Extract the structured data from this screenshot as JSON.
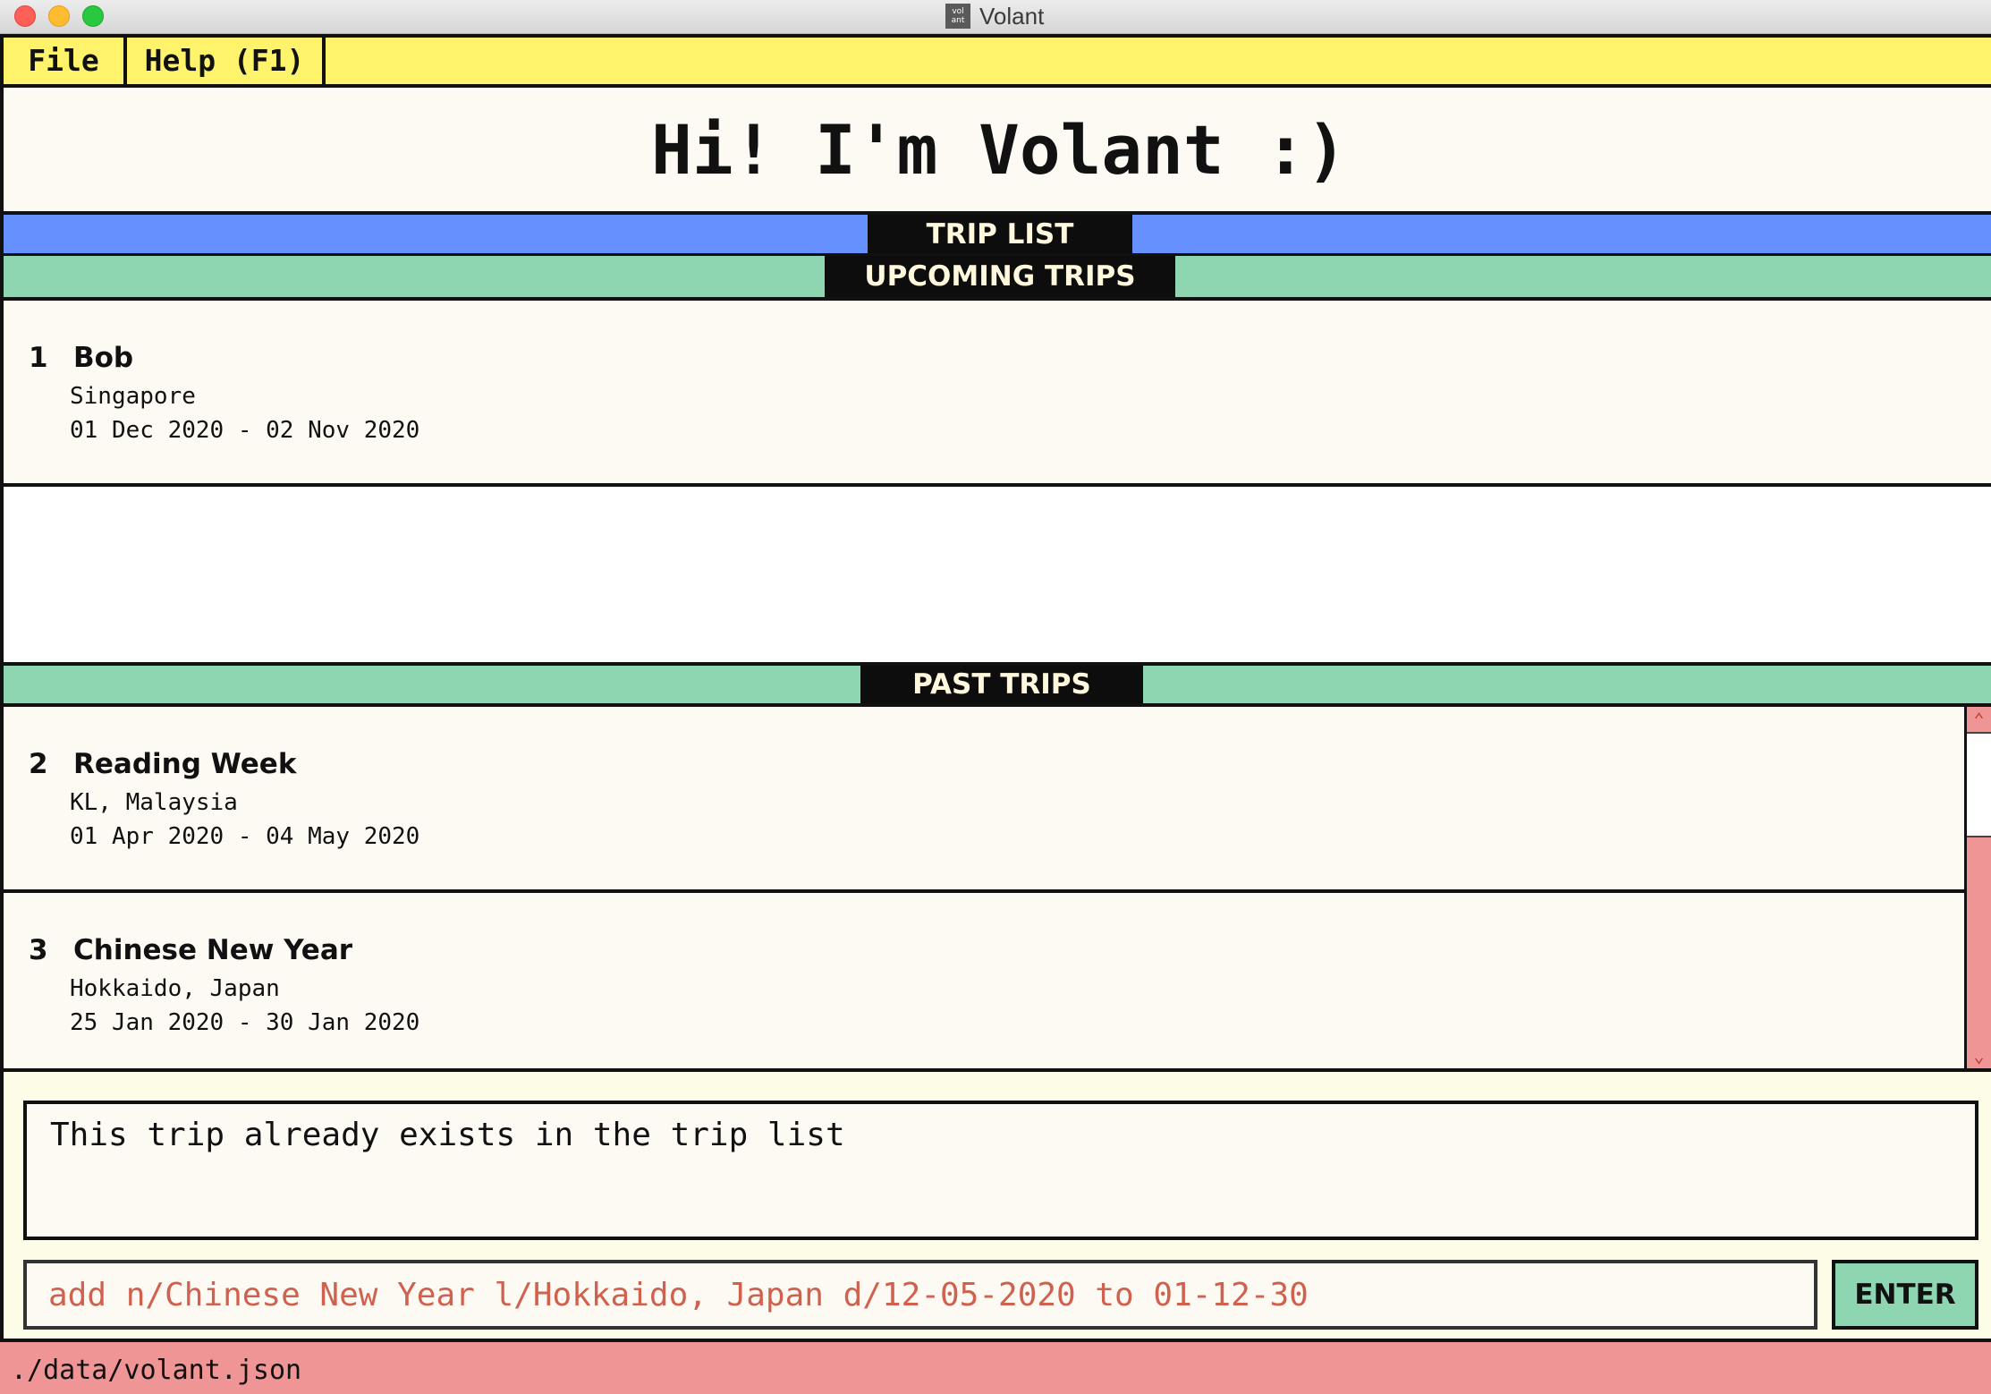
{
  "window": {
    "title": "Volant",
    "icon_label": "vol\nant"
  },
  "menu": {
    "file_label": "File",
    "help_label": "Help (F1)"
  },
  "greeting": "Hi! I'm Volant :)",
  "sections": {
    "trip_list_label": "TRIP LIST",
    "upcoming_label": "UPCOMING TRIPS",
    "past_label": "PAST TRIPS"
  },
  "upcoming_trips": [
    {
      "index": "1",
      "name": "Bob",
      "location": "Singapore",
      "dates": "01 Dec 2020 - 02 Nov 2020"
    }
  ],
  "past_trips": [
    {
      "index": "2",
      "name": "Reading Week",
      "location": "KL, Malaysia",
      "dates": "01 Apr 2020 - 04 May 2020"
    },
    {
      "index": "3",
      "name": "Chinese New Year",
      "location": "Hokkaido, Japan",
      "dates": "25 Jan 2020 - 30 Jan 2020"
    }
  ],
  "result_message": "This trip already exists in the trip list",
  "command": {
    "value": "add n/Chinese New Year l/Hokkaido, Japan d/12-05-2020 to 01-12-30",
    "enter_label": "ENTER"
  },
  "status": {
    "file_path": "./data/volant.json"
  },
  "colors": {
    "menu_bg": "#fff36b",
    "trip_list_bar": "#6790ff",
    "section_bar": "#8ed6b2",
    "status_bar": "#f09595",
    "command_text": "#d0614e"
  }
}
